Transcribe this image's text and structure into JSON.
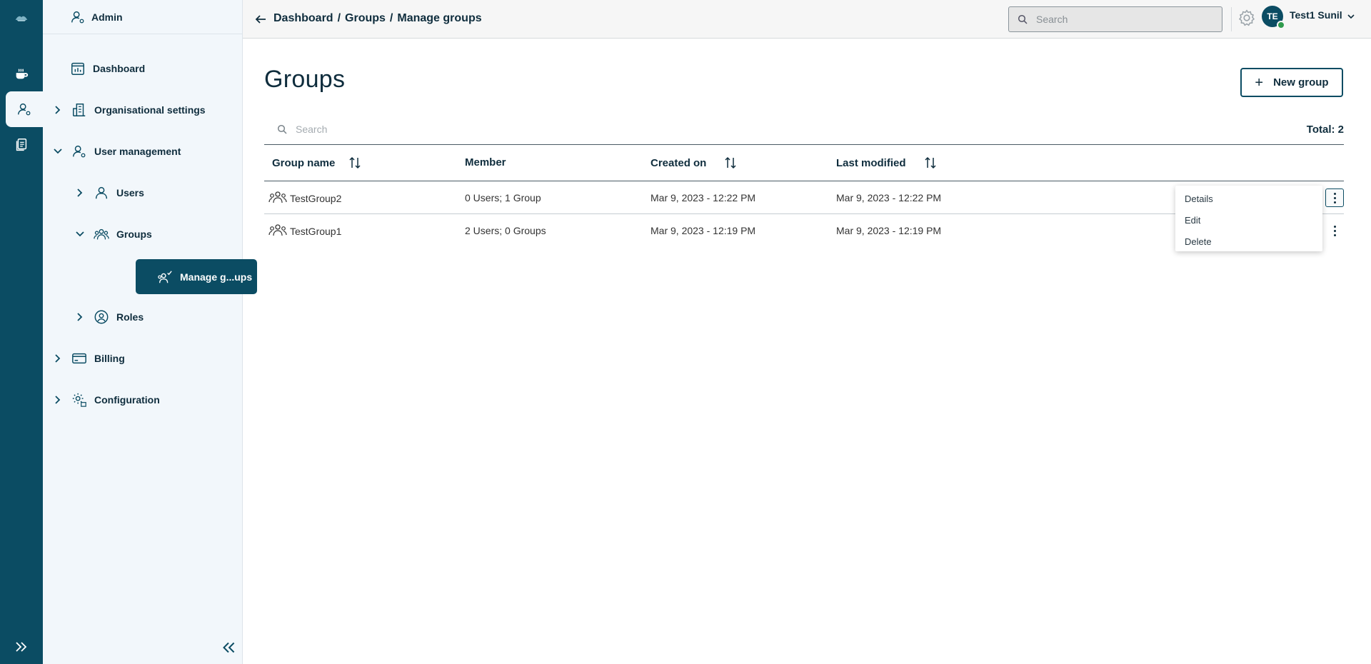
{
  "sidebar": {
    "header": "Admin",
    "items": [
      {
        "label": "Dashboard"
      },
      {
        "label": "Organisational settings"
      },
      {
        "label": "User management"
      },
      {
        "label": "Users"
      },
      {
        "label": "Groups"
      },
      {
        "label": "Manage g...ups"
      },
      {
        "label": "Roles"
      },
      {
        "label": "Billing"
      },
      {
        "label": "Configuration"
      }
    ]
  },
  "topbar": {
    "breadcrumb": [
      "Dashboard",
      "/",
      "Groups",
      "/",
      "Manage groups"
    ],
    "search_placeholder": "Search",
    "user_initials": "TE",
    "user_name": "Test1 Sunil"
  },
  "main": {
    "title": "Groups",
    "new_button": "New group",
    "search_placeholder": "Search",
    "total": "Total: 2",
    "columns": [
      "Group name",
      "Member",
      "Created on",
      "Last modified"
    ],
    "rows": [
      {
        "name": "TestGroup2",
        "member": "0 Users; 1 Group",
        "created": "Mar 9, 2023 - 12:22 PM",
        "modified": "Mar 9, 2023 - 12:22 PM"
      },
      {
        "name": "TestGroup1",
        "member": "2 Users; 0 Groups",
        "created": "Mar 9, 2023 - 12:19 PM",
        "modified": "Mar 9, 2023 - 12:19 PM"
      }
    ],
    "context_menu": [
      "Details",
      "Edit",
      "Delete"
    ]
  },
  "colors": {
    "brand": "#0b4c63",
    "sidebar_bg": "#f2f7fb",
    "online": "#2f9b4d"
  }
}
